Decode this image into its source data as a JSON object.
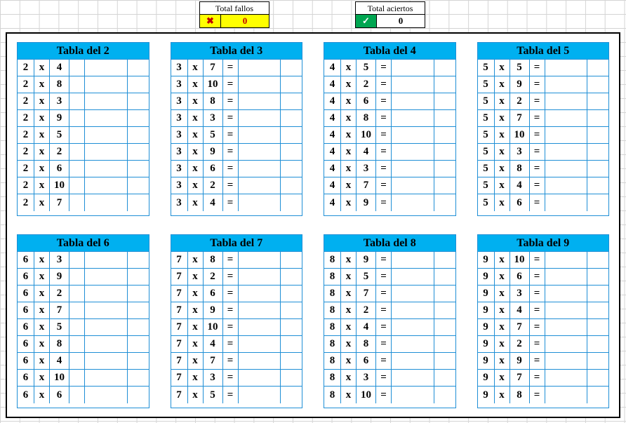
{
  "summary": {
    "fallos_label": "Total fallos",
    "fallos_icon": "✖",
    "fallos_value": "0",
    "aciertos_label": "Total aciertos",
    "aciertos_icon": "✓",
    "aciertos_value": "0"
  },
  "op": "x",
  "eq": "=",
  "tables": [
    {
      "title": "Tabla del 2",
      "a": 2,
      "show_eq": false,
      "b": [
        4,
        8,
        3,
        9,
        5,
        2,
        6,
        10,
        7
      ]
    },
    {
      "title": "Tabla del 3",
      "a": 3,
      "show_eq": true,
      "b": [
        7,
        10,
        8,
        3,
        5,
        9,
        6,
        2,
        4
      ]
    },
    {
      "title": "Tabla del 4",
      "a": 4,
      "show_eq": true,
      "b": [
        5,
        2,
        6,
        8,
        10,
        4,
        3,
        7,
        9
      ]
    },
    {
      "title": "Tabla del 5",
      "a": 5,
      "show_eq": true,
      "b": [
        5,
        9,
        2,
        7,
        10,
        3,
        8,
        4,
        6
      ]
    },
    {
      "title": "Tabla del 6",
      "a": 6,
      "show_eq": false,
      "b": [
        3,
        9,
        2,
        7,
        5,
        8,
        4,
        10,
        6
      ]
    },
    {
      "title": "Tabla del 7",
      "a": 7,
      "show_eq": true,
      "b": [
        8,
        2,
        6,
        9,
        10,
        4,
        7,
        3,
        5
      ]
    },
    {
      "title": "Tabla del 8",
      "a": 8,
      "show_eq": true,
      "b": [
        9,
        5,
        7,
        2,
        4,
        8,
        6,
        3,
        10
      ]
    },
    {
      "title": "Tabla del 9",
      "a": 9,
      "show_eq": true,
      "b": [
        10,
        6,
        3,
        4,
        7,
        2,
        9,
        7,
        8
      ]
    }
  ]
}
